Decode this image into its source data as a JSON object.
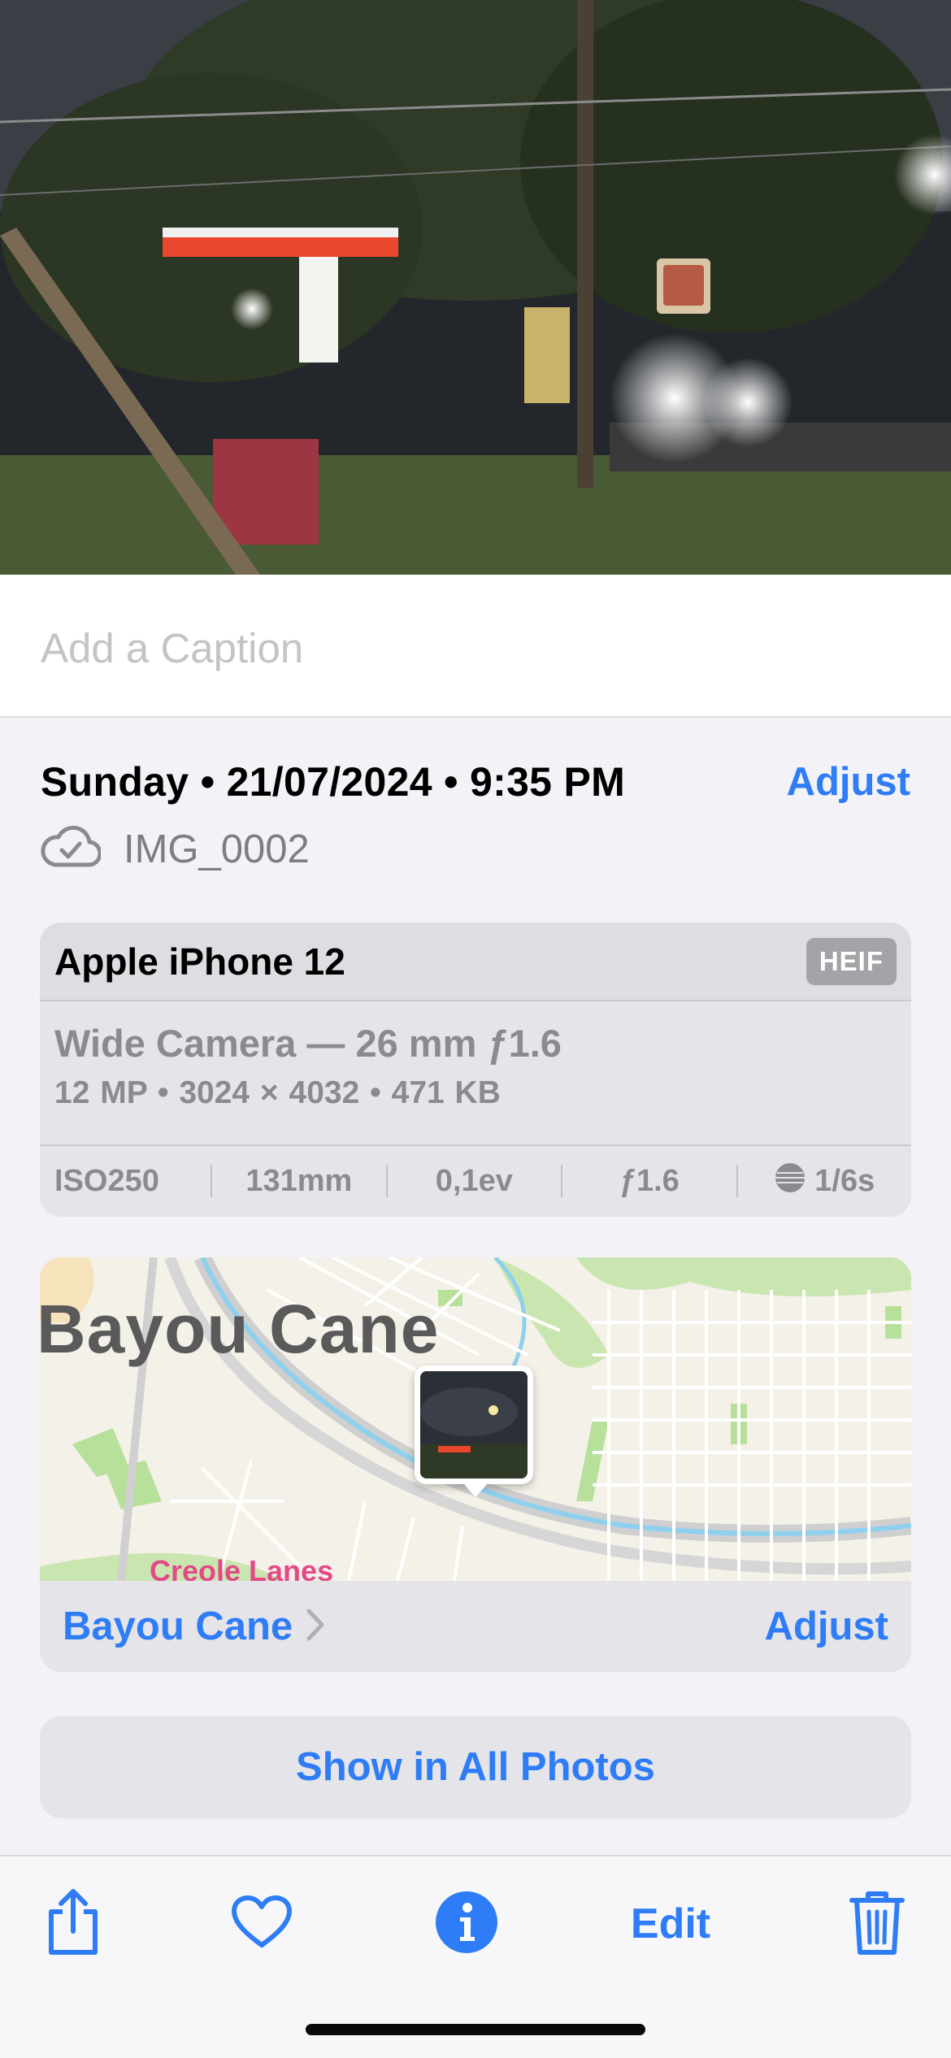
{
  "caption": {
    "placeholder": "Add a Caption"
  },
  "details": {
    "date_line": "Sunday • 21/07/2024 • 9:35 PM",
    "adjust_label": "Adjust",
    "file_name": "IMG_0002"
  },
  "camera": {
    "device": "Apple iPhone 12",
    "format_badge": "HEIF",
    "lens": "Wide Camera — 26 mm ƒ1.6",
    "specs": "12 MP • 3024 × 4032 • 471 KB",
    "exif": {
      "iso": "ISO250",
      "focal": "131mm",
      "ev": "0,1ev",
      "aperture": "ƒ1.6",
      "shutter": "1/6s"
    }
  },
  "location": {
    "map_label_primary": "Bayou Cane",
    "map_label_poi": "Creole Lanes",
    "place_name": "Bayou Cane",
    "adjust_label": "Adjust"
  },
  "show_all_label": "Show in All Photos",
  "toolbar": {
    "share_icon": "share-icon",
    "favorite_icon": "heart-icon",
    "info_icon": "info-icon",
    "edit_label": "Edit",
    "delete_icon": "trash-icon"
  },
  "colors": {
    "accent": "#2f7df6",
    "secondary_text": "#8a8a8f",
    "background": "#f2f2f7"
  }
}
